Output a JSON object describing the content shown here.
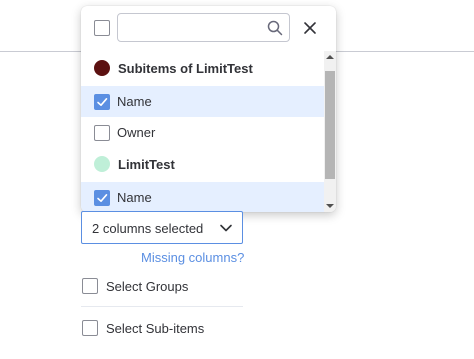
{
  "dropdown": {
    "search": {
      "value": "",
      "placeholder": ""
    },
    "icons": {
      "search": "search-icon",
      "close": "close-icon"
    },
    "rows": [
      {
        "type": "group",
        "label": "Subitems of LimitTest",
        "dot_color": "#5c1111"
      },
      {
        "type": "option",
        "label": "Name",
        "checked": true,
        "selected": true
      },
      {
        "type": "option",
        "label": "Owner",
        "checked": false,
        "selected": false
      },
      {
        "type": "group",
        "label": "LimitTest",
        "dot_color": "#bfefd8"
      },
      {
        "type": "option",
        "label": "Name",
        "checked": true,
        "selected": true
      }
    ]
  },
  "column_select": {
    "value": "2 columns selected",
    "icon": "chevron-down-icon"
  },
  "missing_columns_link": "Missing columns?",
  "options": {
    "select_groups": {
      "label": "Select Groups",
      "checked": false
    },
    "select_subitems": {
      "label": "Select Sub-items",
      "checked": false
    }
  },
  "colors": {
    "accent": "#5b8fe2",
    "selected_row": "#e5efff"
  }
}
